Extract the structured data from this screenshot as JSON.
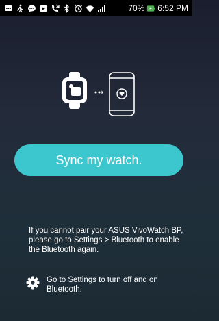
{
  "status_bar": {
    "battery": "70%",
    "time": "6:52 PM",
    "icons": [
      "message-icon",
      "activity-icon",
      "chat-icon",
      "video-icon",
      "missed-call-icon",
      "bluetooth-icon",
      "alarm-icon",
      "wifi-icon",
      "signal-icon",
      "battery-charging-icon"
    ]
  },
  "main": {
    "sync_button_label": "Sync my watch.",
    "help_text": "If you cannot pair your ASUS VivoWatch BP, please go to Settings > Bluetooth to enable the Bluetooth again.",
    "settings_link_text": "Go to Settings to turn off and on Bluetooth."
  },
  "colors": {
    "accent": "#3cc7cf",
    "background_top": "#1a1e2e",
    "background_bottom": "#1c2a33"
  }
}
